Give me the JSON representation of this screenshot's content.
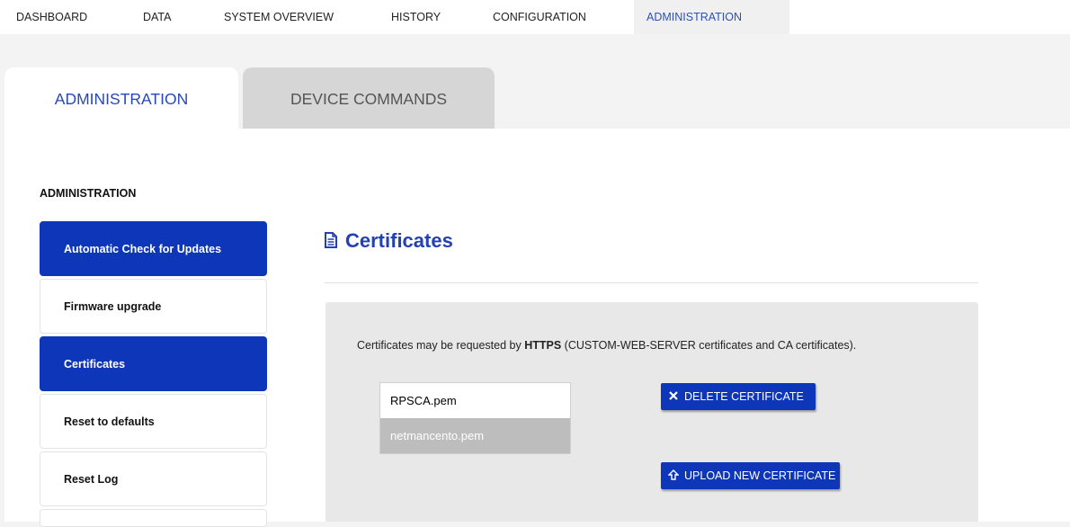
{
  "topnav": {
    "items": [
      "DASHBOARD",
      "DATA",
      "SYSTEM OVERVIEW",
      "HISTORY",
      "CONFIGURATION",
      "ADMINISTRATION"
    ],
    "active": "ADMINISTRATION"
  },
  "tabs": {
    "administration": "ADMINISTRATION",
    "device_commands": "DEVICE COMMANDS"
  },
  "sidebar": {
    "heading": "ADMINISTRATION",
    "items": [
      "Automatic Check for Updates",
      "Firmware upgrade",
      "Certificates",
      "Reset to defaults",
      "Reset Log"
    ]
  },
  "content": {
    "title": "Certificates",
    "info_prefix": "Certificates may be requested by ",
    "info_bold": "HTTPS",
    "info_suffix": " (CUSTOM-WEB-SERVER certificates and CA certificates).",
    "certificates": [
      "RPSCA.pem",
      "netmancento.pem"
    ],
    "selected_certificate": "netmancento.pem",
    "delete_button": "DELETE CERTIFICATE",
    "upload_button": "UPLOAD NEW CERTIFICATE"
  },
  "colors": {
    "accent": "#0e36b8",
    "title": "#2441b4",
    "tab_active_text": "#2747bf"
  },
  "icons": {
    "title": "document-icon",
    "delete": "close-icon",
    "upload": "upload-arrow-icon"
  }
}
